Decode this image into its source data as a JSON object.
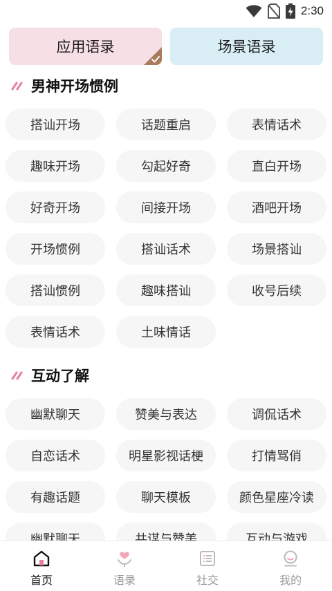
{
  "status_bar": {
    "time": "2:30",
    "icons": [
      "wifi-icon",
      "no-sim-icon",
      "battery-charging-icon"
    ]
  },
  "top_tabs": [
    {
      "label": "应用语录",
      "selected": true,
      "color": "#f7dfe6"
    },
    {
      "label": "场景语录",
      "selected": false,
      "color": "#d9eef4"
    }
  ],
  "sections": [
    {
      "title": "男神开场惯例",
      "items": [
        "搭讪开场",
        "话题重启",
        "表情话术",
        "趣味开场",
        "勾起好奇",
        "直白开场",
        "好奇开场",
        "间接开场",
        "酒吧开场",
        "开场惯例",
        "搭讪话术",
        "场景搭讪",
        "搭讪惯例",
        "趣味搭讪",
        "收号后续",
        "表情话术",
        "土味情话"
      ]
    },
    {
      "title": "互动了解",
      "items": [
        "幽默聊天",
        "赞美与表达",
        "调侃话术",
        "自恋话术",
        "明星影视话梗",
        "打情骂俏",
        "有趣话题",
        "聊天模板",
        "颜色星座冷读",
        "幽默聊天",
        "共谋与赞美",
        "互动与游戏"
      ]
    }
  ],
  "bottom_nav": [
    {
      "label": "首页",
      "icon": "home-icon",
      "active": true
    },
    {
      "label": "语录",
      "icon": "heart-hand-icon",
      "active": false
    },
    {
      "label": "社交",
      "icon": "list-icon",
      "active": false
    },
    {
      "label": "我的",
      "icon": "profile-icon",
      "active": false
    }
  ],
  "colors": {
    "accent_pink": "#e8809a",
    "chip_bg": "#f6f6f6",
    "tab_app_bg": "#f7dfe6",
    "tab_scene_bg": "#d9eef4",
    "corner_check": "#a87a5e"
  }
}
